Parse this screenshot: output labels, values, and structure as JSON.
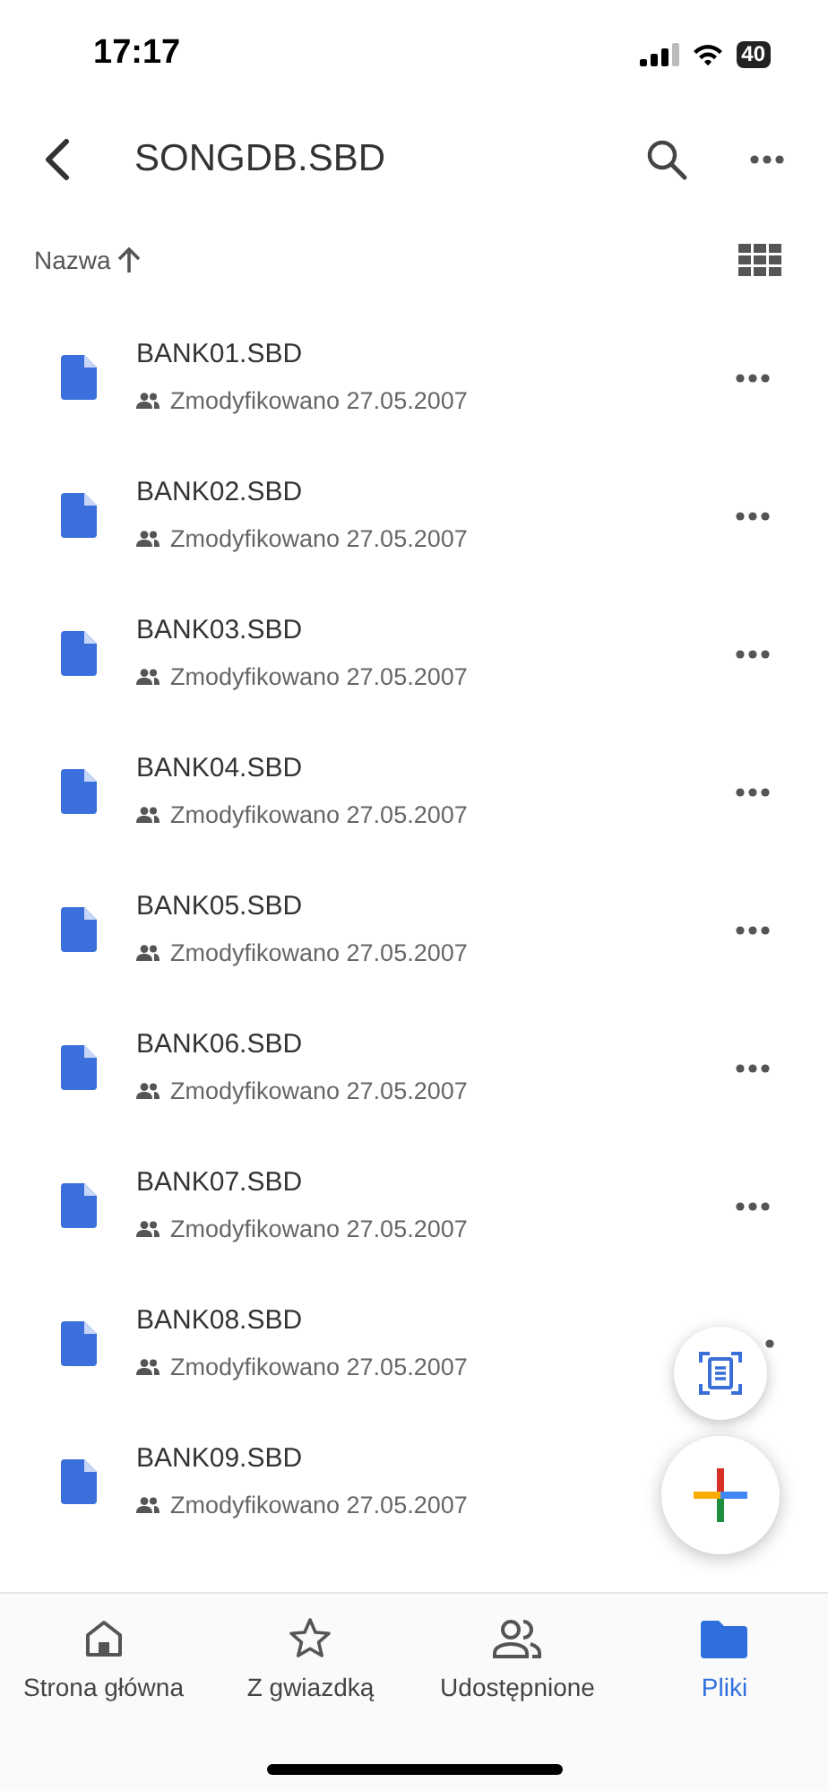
{
  "status_bar": {
    "time": "17:17",
    "battery": "40"
  },
  "header": {
    "title": "SONGDB.SBD"
  },
  "sort": {
    "label": "Nazwa"
  },
  "files": [
    {
      "name": "BANK01.SBD",
      "meta": "Zmodyfikowano 27.05.2007"
    },
    {
      "name": "BANK02.SBD",
      "meta": "Zmodyfikowano 27.05.2007"
    },
    {
      "name": "BANK03.SBD",
      "meta": "Zmodyfikowano 27.05.2007"
    },
    {
      "name": "BANK04.SBD",
      "meta": "Zmodyfikowano 27.05.2007"
    },
    {
      "name": "BANK05.SBD",
      "meta": "Zmodyfikowano 27.05.2007"
    },
    {
      "name": "BANK06.SBD",
      "meta": "Zmodyfikowano 27.05.2007"
    },
    {
      "name": "BANK07.SBD",
      "meta": "Zmodyfikowano 27.05.2007"
    },
    {
      "name": "BANK08.SBD",
      "meta": "Zmodyfikowano 27.05.2007"
    },
    {
      "name": "BANK09.SBD",
      "meta": "Zmodyfikowano 27.05.2007"
    }
  ],
  "bottom_nav": [
    {
      "kind": "home",
      "label": "Strona główna",
      "selected": false
    },
    {
      "kind": "starred",
      "label": "Z gwiazdką",
      "selected": false
    },
    {
      "kind": "shared",
      "label": "Udostępnione",
      "selected": false
    },
    {
      "kind": "files",
      "label": "Pliki",
      "selected": true
    }
  ]
}
